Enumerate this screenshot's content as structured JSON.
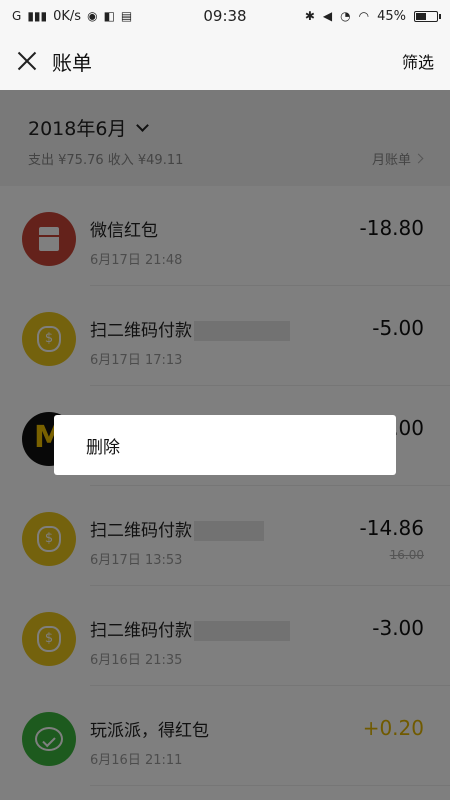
{
  "status_bar": {
    "signal": "G",
    "network_speed": "0K/s",
    "time": "09:38",
    "battery_percent": "45%",
    "battery_level": 0.45
  },
  "header": {
    "title": "账单",
    "filter_label": "筛选"
  },
  "summary": {
    "month": "2018年6月",
    "stats": "支出 ¥75.76 收入 ¥49.11",
    "monthly_bill_label": "月账单"
  },
  "transactions": [
    {
      "title": "微信红包",
      "date": "6月17日 21:48",
      "amount": "-18.80",
      "icon": "red-envelope-icon",
      "color": "#c94437"
    },
    {
      "title": "扫二维码付款",
      "date": "6月17日 17:13",
      "amount": "-5.00",
      "icon": "money-bag-icon",
      "color": "#e9c41b"
    },
    {
      "title": "",
      "date": "",
      "amount": ".00",
      "icon": "mcdonalds-logo-icon",
      "color": "#111111"
    },
    {
      "title": "扫二维码付款",
      "date": "6月17日 13:53",
      "amount": "-14.86",
      "original": "16.00",
      "icon": "money-bag-icon",
      "color": "#e9c41b"
    },
    {
      "title": "扫二维码付款",
      "date": "6月16日 21:35",
      "amount": "-3.00",
      "icon": "money-bag-icon",
      "color": "#e9c41b"
    },
    {
      "title": "玩派派，得红包",
      "date": "6月16日 21:11",
      "amount": "+0.20",
      "icon": "chat-bubble-icon",
      "color": "#3bb53c"
    }
  ],
  "dialog": {
    "delete_label": "删除"
  }
}
